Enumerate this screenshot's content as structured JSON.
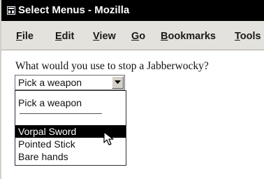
{
  "window": {
    "title": "Select Menus - Mozilla"
  },
  "menubar": {
    "items": [
      {
        "first": "F",
        "rest": "ile"
      },
      {
        "first": "E",
        "rest": "dit"
      },
      {
        "first": "V",
        "rest": "iew"
      },
      {
        "first": "G",
        "rest": "o"
      },
      {
        "first": "B",
        "rest": "ookmarks"
      },
      {
        "first": "T",
        "rest": "ools"
      }
    ]
  },
  "page": {
    "question": "What would you use to stop a Jabberwocky?",
    "select": {
      "value": "Pick a weapon",
      "options": [
        "Pick a weapon",
        "Vorpal Sword",
        "Pointed Stick",
        "Bare hands"
      ],
      "highlighted": "Vorpal Sword"
    }
  },
  "icons": {
    "app": "app-window-icon",
    "arrow": "chevron-down-icon",
    "cursor": "mouse-pointer-icon"
  }
}
